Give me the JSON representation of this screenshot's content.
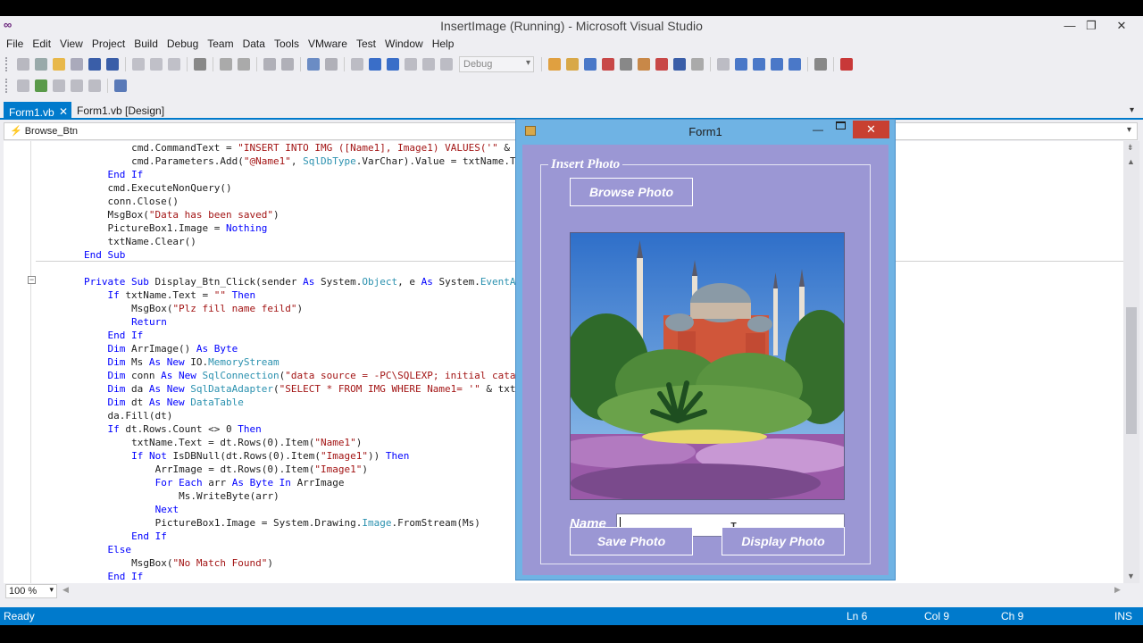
{
  "window": {
    "title": "InsertImage (Running) - Microsoft Visual Studio",
    "min": "—",
    "restore": "❐",
    "close": "✕"
  },
  "menu": [
    "File",
    "Edit",
    "View",
    "Project",
    "Build",
    "Debug",
    "Team",
    "Data",
    "Tools",
    "VMware",
    "Test",
    "Window",
    "Help"
  ],
  "toolbar": {
    "config": "Debug"
  },
  "tabs": {
    "active": "Form1.vb",
    "active_close": "✕",
    "inactive": "Form1.vb [Design]"
  },
  "navbar": {
    "member": "Browse_Btn"
  },
  "code": [
    {
      "indent": 16,
      "parts": [
        [
          "",
          "cmd.CommandText = "
        ],
        [
          "str",
          "\"INSERT INTO IMG ([Name1], Image1) VALUES('\""
        ],
        [
          "",
          " & txtNa"
        ]
      ]
    },
    {
      "indent": 16,
      "parts": [
        [
          "",
          "cmd.Parameters.Add("
        ],
        [
          "str",
          "\"@Name1\""
        ],
        [
          "",
          ", "
        ],
        [
          "ty",
          "SqlDbType"
        ],
        [
          "",
          ".VarChar).Value = txtName.Text"
        ]
      ]
    },
    {
      "indent": 12,
      "parts": [
        [
          "kw",
          "End If"
        ]
      ]
    },
    {
      "indent": 12,
      "parts": [
        [
          "",
          "cmd.ExecuteNonQuery()"
        ]
      ]
    },
    {
      "indent": 12,
      "parts": [
        [
          "",
          "conn.Close()"
        ]
      ]
    },
    {
      "indent": 12,
      "parts": [
        [
          "",
          "MsgBox("
        ],
        [
          "str",
          "\"Data has been saved\""
        ],
        [
          "",
          ")"
        ]
      ]
    },
    {
      "indent": 12,
      "parts": [
        [
          "",
          "PictureBox1.Image = "
        ],
        [
          "kw",
          "Nothing"
        ]
      ]
    },
    {
      "indent": 12,
      "parts": [
        [
          "",
          "txtName.Clear()"
        ]
      ]
    },
    {
      "indent": 8,
      "parts": [
        [
          "kw",
          "End Sub"
        ]
      ]
    },
    {
      "indent": 0,
      "parts": []
    },
    {
      "indent": 8,
      "parts": [
        [
          "kw",
          "Private Sub "
        ],
        [
          "",
          "Display_Btn_Click(sender "
        ],
        [
          "kw",
          "As "
        ],
        [
          "",
          "System."
        ],
        [
          "ty",
          "Object"
        ],
        [
          "",
          ", e "
        ],
        [
          "kw",
          "As "
        ],
        [
          "",
          "System."
        ],
        [
          "ty",
          "EventArgs"
        ],
        [
          "",
          ")"
        ]
      ]
    },
    {
      "indent": 12,
      "parts": [
        [
          "kw",
          "If "
        ],
        [
          "",
          "txtName.Text = "
        ],
        [
          "str",
          "\"\""
        ],
        [
          "kw",
          " Then"
        ]
      ]
    },
    {
      "indent": 16,
      "parts": [
        [
          "",
          "MsgBox("
        ],
        [
          "str",
          "\"Plz fill name feild\""
        ],
        [
          "",
          ")"
        ]
      ]
    },
    {
      "indent": 16,
      "parts": [
        [
          "kw",
          "Return"
        ]
      ]
    },
    {
      "indent": 12,
      "parts": [
        [
          "kw",
          "End If"
        ]
      ]
    },
    {
      "indent": 12,
      "parts": [
        [
          "kw",
          "Dim "
        ],
        [
          "",
          "ArrImage() "
        ],
        [
          "kw",
          "As Byte"
        ]
      ]
    },
    {
      "indent": 12,
      "parts": [
        [
          "kw",
          "Dim "
        ],
        [
          "",
          "Ms "
        ],
        [
          "kw",
          "As New "
        ],
        [
          "",
          "IO."
        ],
        [
          "ty",
          "MemoryStream"
        ]
      ]
    },
    {
      "indent": 12,
      "parts": [
        [
          "kw",
          "Dim "
        ],
        [
          "",
          "conn "
        ],
        [
          "kw",
          "As New "
        ],
        [
          "ty",
          "SqlConnection"
        ],
        [
          "",
          "("
        ],
        [
          "str",
          "\"data source = -PC\\SQLEXP; initial catalog="
        ]
      ]
    },
    {
      "indent": 12,
      "parts": [
        [
          "kw",
          "Dim "
        ],
        [
          "",
          "da "
        ],
        [
          "kw",
          "As New "
        ],
        [
          "ty",
          "SqlDataAdapter"
        ],
        [
          "",
          "("
        ],
        [
          "str",
          "\"SELECT * FROM IMG WHERE Name1= '\""
        ],
        [
          "",
          " & txtName."
        ]
      ]
    },
    {
      "indent": 12,
      "parts": [
        [
          "kw",
          "Dim "
        ],
        [
          "",
          "dt "
        ],
        [
          "kw",
          "As New "
        ],
        [
          "ty",
          "DataTable"
        ]
      ]
    },
    {
      "indent": 12,
      "parts": [
        [
          "",
          "da.Fill(dt)"
        ]
      ]
    },
    {
      "indent": 12,
      "parts": [
        [
          "kw",
          "If "
        ],
        [
          "",
          "dt.Rows.Count <> 0 "
        ],
        [
          "kw",
          "Then"
        ]
      ]
    },
    {
      "indent": 16,
      "parts": [
        [
          "",
          "txtName.Text = dt.Rows(0).Item("
        ],
        [
          "str",
          "\"Name1\""
        ],
        [
          "",
          ")"
        ]
      ]
    },
    {
      "indent": 16,
      "parts": [
        [
          "kw",
          "If Not "
        ],
        [
          "",
          "IsDBNull(dt.Rows(0).Item("
        ],
        [
          "str",
          "\"Image1\""
        ],
        [
          "",
          ")) "
        ],
        [
          "kw",
          "Then"
        ]
      ]
    },
    {
      "indent": 20,
      "parts": [
        [
          "",
          "ArrImage = dt.Rows(0).Item("
        ],
        [
          "str",
          "\"Image1\""
        ],
        [
          "",
          ")"
        ]
      ]
    },
    {
      "indent": 20,
      "parts": [
        [
          "kw",
          "For Each "
        ],
        [
          "",
          "arr "
        ],
        [
          "kw",
          "As Byte In "
        ],
        [
          "",
          "ArrImage"
        ]
      ]
    },
    {
      "indent": 24,
      "parts": [
        [
          "",
          "Ms.WriteByte(arr)"
        ]
      ]
    },
    {
      "indent": 20,
      "parts": [
        [
          "kw",
          "Next"
        ]
      ]
    },
    {
      "indent": 20,
      "parts": [
        [
          "",
          "PictureBox1.Image = System.Drawing."
        ],
        [
          "ty",
          "Image"
        ],
        [
          "",
          ".FromStream(Ms)"
        ]
      ]
    },
    {
      "indent": 16,
      "parts": [
        [
          "kw",
          "End If"
        ]
      ]
    },
    {
      "indent": 12,
      "parts": [
        [
          "kw",
          "Else"
        ]
      ]
    },
    {
      "indent": 16,
      "parts": [
        [
          "",
          "MsgBox("
        ],
        [
          "str",
          "\"No Match Found\""
        ],
        [
          "",
          ")"
        ]
      ]
    },
    {
      "indent": 12,
      "parts": [
        [
          "kw",
          "End If"
        ]
      ]
    }
  ],
  "zoom": "100 %",
  "status": {
    "state": "Ready",
    "ln": "Ln 6",
    "col": "Col 9",
    "ch": "Ch 9",
    "mode": "INS"
  },
  "form": {
    "title": "Form1",
    "min": "—",
    "close": "✕",
    "group_label": "Insert Photo",
    "browse_label": "Browse Photo",
    "name_label": "Name",
    "name_value": "",
    "save_label": "Save Photo",
    "display_label": "Display Photo"
  },
  "colors": {
    "accent": "#007acc",
    "form_bg": "#9b97d4",
    "form_border": "#6fb3e4",
    "close_red": "#c84031"
  }
}
